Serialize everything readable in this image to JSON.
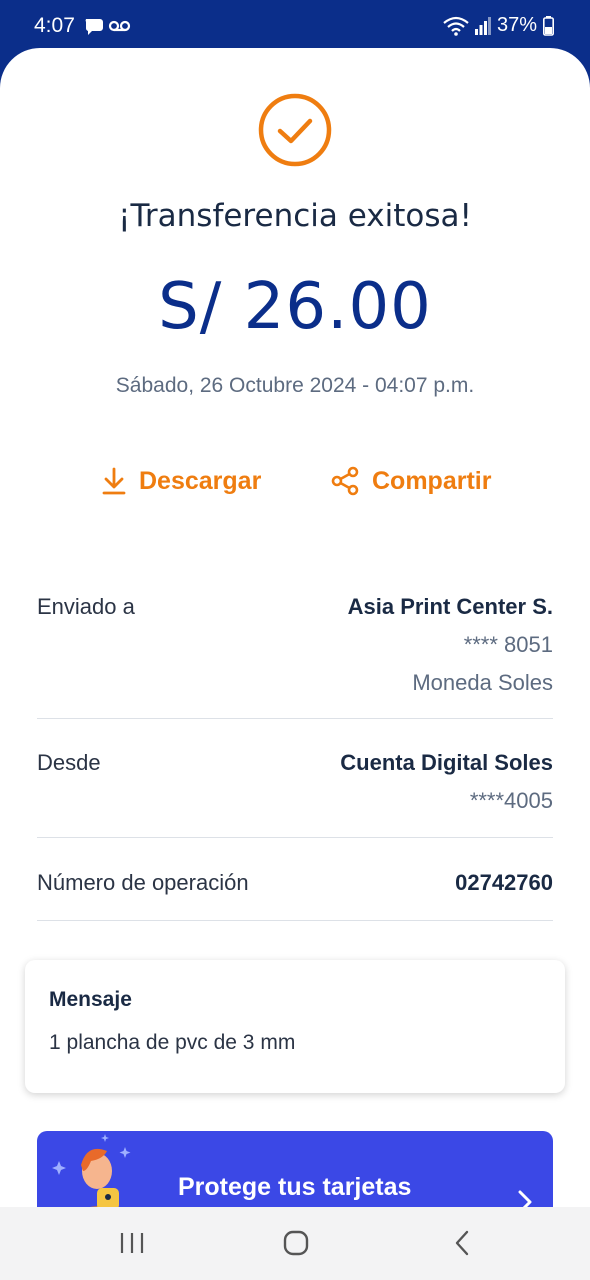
{
  "status_bar": {
    "time": "4:07",
    "battery": "37%"
  },
  "receipt": {
    "headline": "¡Transferencia exitosa!",
    "amount": "S/ 26.00",
    "datetime": "Sábado, 26 Octubre 2024 - 04:07 p.m."
  },
  "actions": {
    "download_label": "Descargar",
    "share_label": "Compartir"
  },
  "details": {
    "sent_to": {
      "label": "Enviado a",
      "name": "Asia Print Center S.",
      "account": "**** 8051",
      "currency": "Moneda Soles"
    },
    "from": {
      "label": "Desde",
      "name": "Cuenta Digital Soles",
      "account": "****4005"
    },
    "operation": {
      "label": "Número de operación",
      "number": "02742760"
    }
  },
  "message": {
    "title": "Mensaje",
    "text": "1 plancha de pvc de 3 mm"
  },
  "promo": {
    "text": "Protege tus tarjetas"
  },
  "colors": {
    "brand_blue": "#0b2e8a",
    "accent_orange": "#ef7d10",
    "promo_blue": "#3b48e6"
  }
}
